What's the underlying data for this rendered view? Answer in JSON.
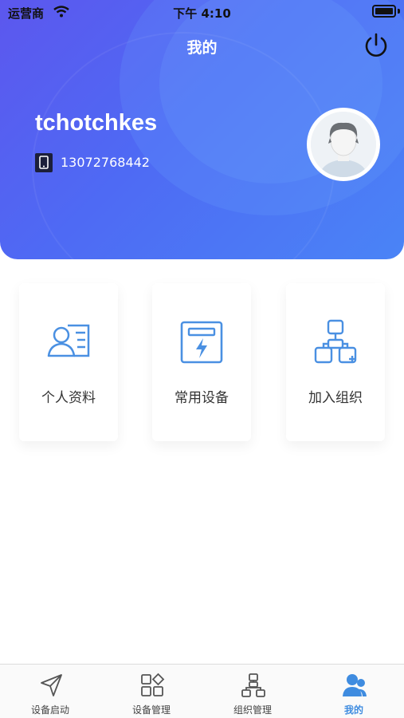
{
  "status_bar": {
    "carrier": "运营商",
    "time": "下午 4:10"
  },
  "header": {
    "title": "我的",
    "username": "tchotchkes",
    "phone": "13072768442"
  },
  "menu": [
    {
      "label": "个人资料",
      "icon": "profile-card-icon"
    },
    {
      "label": "常用设备",
      "icon": "device-lightning-icon"
    },
    {
      "label": "加入组织",
      "icon": "org-chart-icon"
    }
  ],
  "tabbar": {
    "tabs": [
      {
        "label": "设备启动",
        "icon": "navigation-arrow-icon",
        "active": false
      },
      {
        "label": "设备管理",
        "icon": "grid-squares-icon",
        "active": false
      },
      {
        "label": "组织管理",
        "icon": "org-tree-icon",
        "active": false
      },
      {
        "label": "我的",
        "icon": "user-group-icon",
        "active": true
      }
    ],
    "active_color": "#3f8ce0"
  },
  "colors": {
    "header_gradient_start": "#5c57ee",
    "header_gradient_end": "#4a84f6",
    "icon_blue": "#4a90e2"
  }
}
